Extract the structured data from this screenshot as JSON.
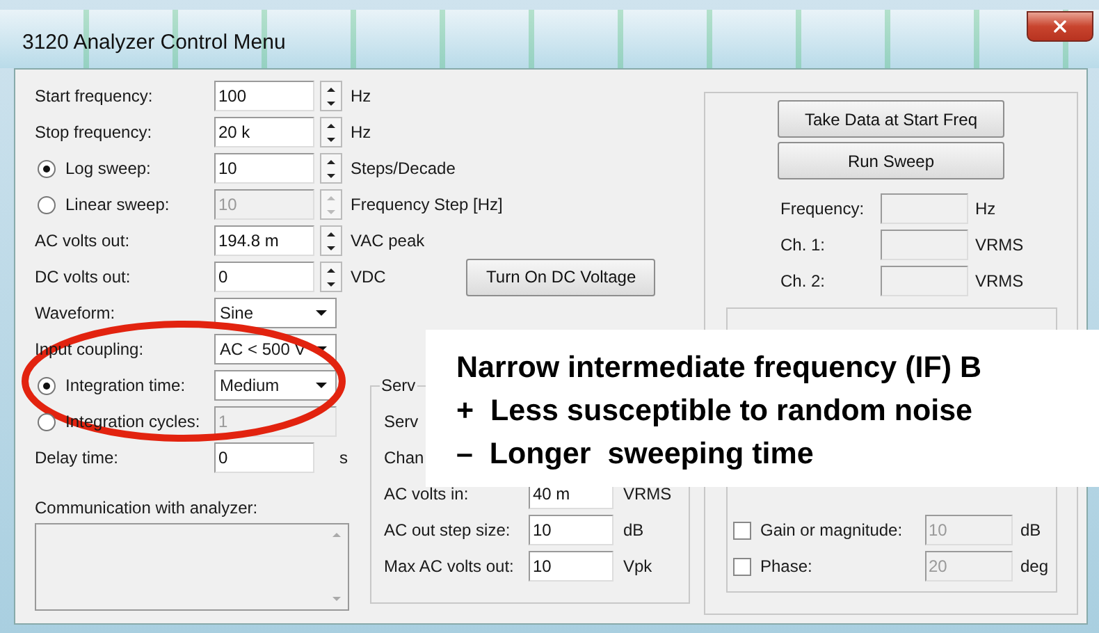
{
  "window": {
    "title": "3120 Analyzer Control Menu"
  },
  "settings": [
    {
      "kind": "spin",
      "label": "Start frequency:",
      "value": "100",
      "unit": "Hz",
      "disabled": false
    },
    {
      "kind": "spin",
      "label": "Stop frequency:",
      "value": "20 k",
      "unit": "Hz",
      "disabled": false
    },
    {
      "kind": "radio-spin",
      "label": "Log sweep:",
      "selected": true,
      "value": "10",
      "unit": "Steps/Decade",
      "disabled": false
    },
    {
      "kind": "radio-spin",
      "label": "Linear sweep:",
      "selected": false,
      "value": "10",
      "unit": "Frequency Step [Hz]",
      "disabled": true
    },
    {
      "kind": "spin",
      "label": "AC volts out:",
      "value": "194.8 m",
      "unit": "VAC peak",
      "disabled": false
    },
    {
      "kind": "spin",
      "label": "DC volts out:",
      "value": "0",
      "unit": "VDC",
      "disabled": false
    }
  ],
  "dc_button": "Turn On DC Voltage",
  "more_settings": [
    {
      "kind": "dropdown",
      "label": "Waveform:",
      "value": "Sine",
      "disabled": false
    },
    {
      "kind": "dropdown",
      "label": "Input coupling:",
      "value": "AC < 500 V",
      "disabled": false
    },
    {
      "kind": "radio-dropdown",
      "label": "Integration time:",
      "selected": true,
      "value": "Medium",
      "disabled": false
    },
    {
      "kind": "radio-field",
      "label": "Integration cycles:",
      "selected": false,
      "value": "1",
      "disabled": true
    },
    {
      "kind": "field",
      "label": "Delay time:",
      "value": "0",
      "unit": "s",
      "disabled": false
    }
  ],
  "communication": {
    "label": "Communication with analyzer:"
  },
  "servo": {
    "title": "Serv",
    "rows": [
      {
        "kind": "text",
        "label": "Serv"
      },
      {
        "kind": "text",
        "label": "Chan"
      },
      {
        "kind": "field",
        "label": "AC volts in:",
        "value": "40 m",
        "unit": "VRMS"
      },
      {
        "kind": "field",
        "label": "AC out step size:",
        "value": "10",
        "unit": "dB"
      },
      {
        "kind": "field",
        "label": "Max AC volts out:",
        "value": "10",
        "unit": "Vpk"
      }
    ]
  },
  "actions": [
    "Take Data at Start Freq",
    "Run Sweep"
  ],
  "readings": [
    {
      "label": "Frequency:",
      "unit": "Hz"
    },
    {
      "label": "Ch. 1:",
      "unit": "VRMS"
    },
    {
      "label": "Ch. 2:",
      "unit": "VRMS"
    }
  ],
  "limits": [
    {
      "label": "Gain or magnitude:",
      "checked": false,
      "value": "10",
      "unit": "dB",
      "disabled": true
    },
    {
      "label": "Phase:",
      "checked": false,
      "value": "20",
      "unit": "deg",
      "disabled": true
    }
  ],
  "annotation": {
    "lines": [
      "Narrow intermediate frequency (IF) B",
      "+  Less susceptible to random noise",
      "–  Longer  sweeping time"
    ]
  }
}
